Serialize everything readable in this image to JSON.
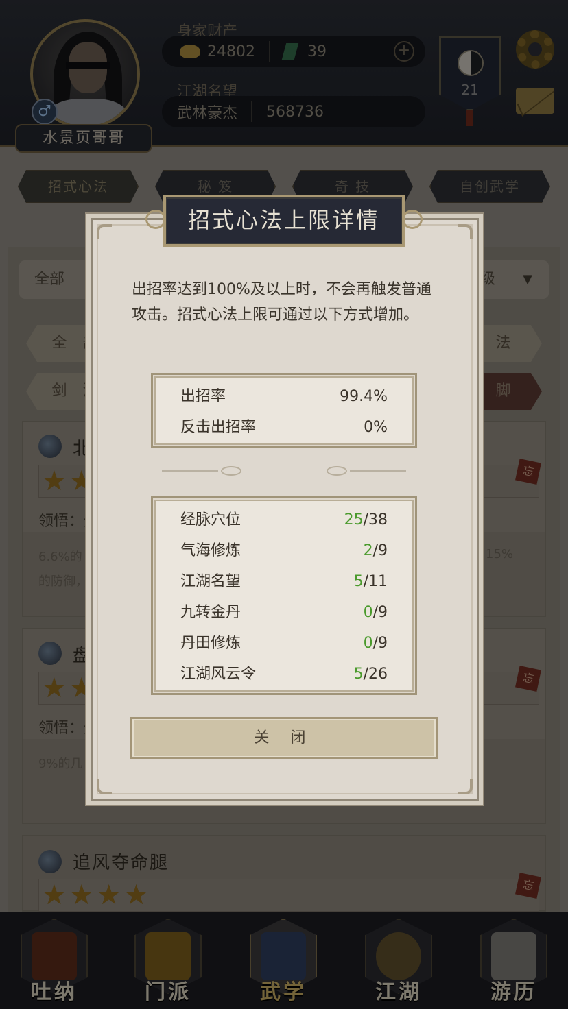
{
  "header": {
    "player_name": "水景页哥哥",
    "gender_symbol": "♂",
    "wealth_label": "身家财产",
    "gold": "24802",
    "jade": "39",
    "plus_symbol": "+",
    "reputation_label": "江湖名望",
    "reputation_title": "武林豪杰",
    "reputation_value": "568736",
    "level": "21",
    "icons": {
      "settings": "gear-icon",
      "mail": "mail-icon",
      "gold": "ingot-icon",
      "jade": "jade-icon",
      "badge": "taiji-icon"
    }
  },
  "tabs": [
    "招式心法",
    "秘 笈",
    "奇 技",
    "自创武学"
  ],
  "background": {
    "filter_label": "全部",
    "filter_right": "级",
    "chips_row1": [
      "全 部",
      "刀 法"
    ],
    "chips_row2": [
      "剑 法",
      "腿 脚"
    ],
    "cards": [
      {
        "name": "北",
        "insight_label": "领悟：无",
        "desc_left": "6.6%的",
        "desc_right": "15%",
        "desc_line2": "的防御，"
      },
      {
        "name": "盘",
        "insight_label": "领悟：无",
        "desc_left": "9%的几"
      },
      {
        "name": "追风夺命腿"
      }
    ],
    "forget_tag": "忘"
  },
  "bottom_nav": [
    {
      "label": "吐纳",
      "icon": "meditation-icon"
    },
    {
      "label": "门派",
      "icon": "banner-icon"
    },
    {
      "label": "武学",
      "icon": "book-icon"
    },
    {
      "label": "江湖",
      "icon": "hat-icon"
    },
    {
      "label": "游历",
      "icon": "horse-icon"
    }
  ],
  "dialog": {
    "title": "招式心法上限详情",
    "description": "出招率达到100%及以上时，不会再触发普通攻击。招式心法上限可通过以下方式增加。",
    "rates": [
      {
        "label": "出招率",
        "value": "99.4%"
      },
      {
        "label": "反击出招率",
        "value": "0%"
      }
    ],
    "sources": [
      {
        "label": "经脉穴位",
        "current": "25",
        "max": "/38"
      },
      {
        "label": "气海修炼",
        "current": "2",
        "max": "/9"
      },
      {
        "label": "江湖名望",
        "current": "5",
        "max": "/11"
      },
      {
        "label": "九转金丹",
        "current": "0",
        "max": "/9"
      },
      {
        "label": "丹田修炼",
        "current": "0",
        "max": "/9"
      },
      {
        "label": "江湖风云令",
        "current": "5",
        "max": "/26"
      }
    ],
    "close_label": "关 闭"
  },
  "colors": {
    "accent_gold": "#a99873",
    "progress_green": "#4a9a2c",
    "title_plate": "#262935"
  }
}
